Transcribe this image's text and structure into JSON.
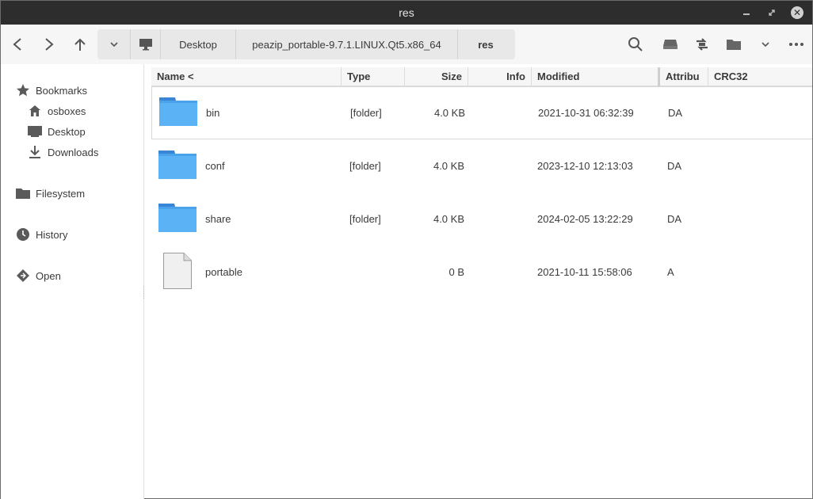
{
  "window": {
    "title": "res"
  },
  "toolbar": {
    "path": [
      "Desktop",
      "peazip_portable-9.7.1.LINUX.Qt5.x86_64",
      "res"
    ],
    "icons": [
      "back-icon",
      "forward-icon",
      "up-icon",
      "chevron-down-icon",
      "computer-icon",
      "search-icon",
      "drive-icon",
      "swap-icon",
      "folder-icon",
      "chevron-down-icon",
      "more-icon"
    ]
  },
  "sidebar": {
    "bookmarks_label": "Bookmarks",
    "items": [
      {
        "label": "osboxes",
        "icon": "home-icon"
      },
      {
        "label": "Desktop",
        "icon": "desktop-icon"
      },
      {
        "label": "Downloads",
        "icon": "download-icon"
      }
    ],
    "filesystem_label": "Filesystem",
    "history_label": "History",
    "open_label": "Open"
  },
  "list": {
    "columns": [
      "Name <",
      "Type",
      "Size",
      "Info",
      "Modified",
      "Attribu",
      "CRC32"
    ],
    "rows": [
      {
        "name": "bin",
        "type": "[folder]",
        "size": "4.0 KB",
        "modified": "2021-10-31 06:32:39",
        "attr": "DA",
        "icon": "folder-icon"
      },
      {
        "name": "conf",
        "type": "[folder]",
        "size": "4.0 KB",
        "modified": "2023-12-10 12:13:03",
        "attr": "DA",
        "icon": "folder-icon"
      },
      {
        "name": "share",
        "type": "[folder]",
        "size": "4.0 KB",
        "modified": "2024-02-05 13:22:29",
        "attr": "DA",
        "icon": "folder-icon"
      },
      {
        "name": "portable",
        "type": "",
        "size": "0 B",
        "modified": "2021-10-11 15:58:06",
        "attr": "A",
        "icon": "file-icon"
      }
    ]
  },
  "colors": {
    "titlebar": "#2d2d2d",
    "folder": "#5bb2f5",
    "folder_tab": "#3a86d6"
  }
}
